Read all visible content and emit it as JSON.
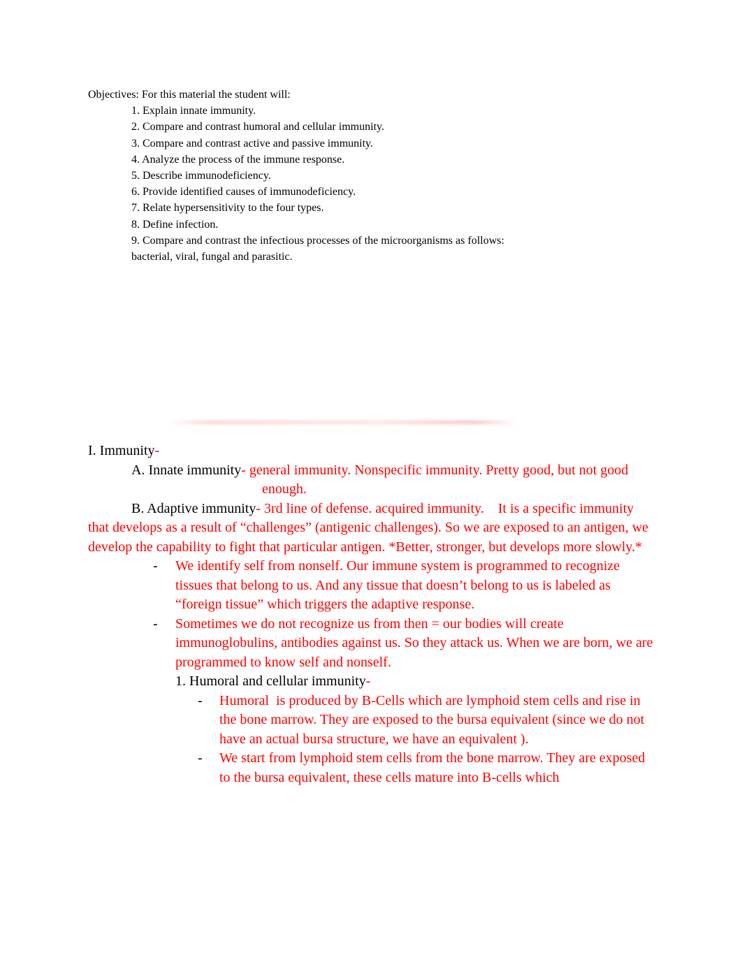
{
  "objectives": {
    "heading": "Objectives: For this material the student will:",
    "items": [
      "1. Explain innate immunity.",
      "2. Compare and contrast humoral and cellular immunity.",
      "3. Compare and contrast active and passive immunity.",
      "4. Analyze the process of the immune response.",
      "5. Describe immunodeficiency.",
      "6. Provide identified causes of immunodeficiency.",
      "7. Relate hypersensitivity to the four types.",
      "8. Define infection.",
      "9. Compare and contrast the infectious processes of the microorganisms as follows: bacterial, viral, fungal and parasitic."
    ]
  },
  "notes": {
    "section_I": {
      "title": "I. Immunity",
      "dash": "-"
    },
    "section_A": {
      "title": "A. Innate immunity",
      "dash": "- ",
      "text_line1": "general immunity. Nonspecific immunity. Pretty good, but not good",
      "text_line2": "enough."
    },
    "section_B": {
      "title": "B. Adaptive immunity",
      "dash": "- ",
      "text": "3rd line of defense. acquired immunity.    It is a specific immunity that develops as a result of “challenges” (antigenic challenges). So we are exposed to an antigen, we develop the capability to fight that particular antigen. *Better, stronger, but develops more slowly.*"
    },
    "bullets_B": [
      "We identify self from nonself. Our immune system is programmed to recognize tissues that belong to us. And any tissue that doesn’t belong to us is labeled as “foreign tissue” which triggers the adaptive response.",
      "Sometimes we do not recognize us from then = our bodies will create immunoglobulins, antibodies against us. So they attack us. When we are born, we are programmed to know self and nonself."
    ],
    "subsection_1": {
      "title": "1. Humoral and cellular immunity",
      "dash": "-",
      "bullets": [
        "Humoral  is produced by B-Cells which are lymphoid stem cells and rise in the bone marrow. They are exposed to the bursa equivalent (since we do not have an actual bursa structure, we have an equivalent ).",
        "We start from lymphoid stem cells from the bone marrow. They are exposed to the bursa equivalent, these cells mature into B-cells which"
      ]
    },
    "bullet_marker": "-"
  },
  "colors": {
    "annotation_text": "#ff0000",
    "body_text": "#000000"
  }
}
